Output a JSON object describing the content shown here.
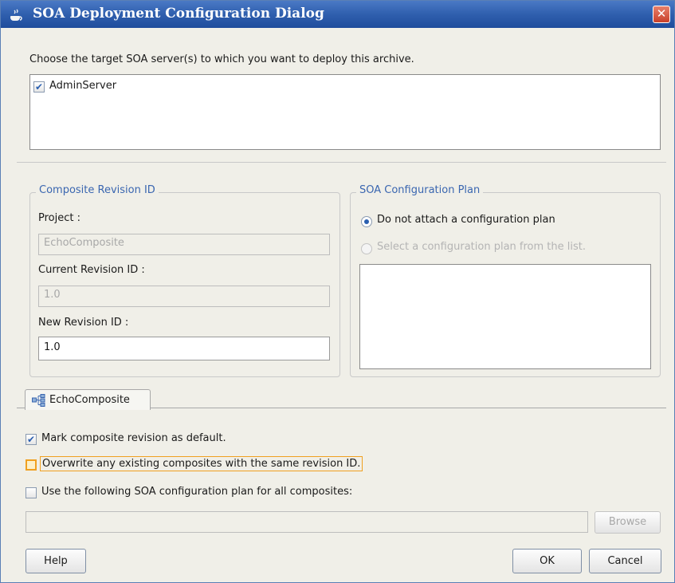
{
  "window": {
    "title": "SOA Deployment Configuration Dialog",
    "close_icon": "✕"
  },
  "target": {
    "prompt": "Choose the target SOA server(s) to which you want to deploy this archive.",
    "servers": [
      {
        "label": "AdminServer",
        "checked": true
      }
    ]
  },
  "revision": {
    "group_title": "Composite Revision ID",
    "project_label": "Project :",
    "project_value": "EchoComposite",
    "current_label": "Current Revision ID :",
    "current_value": "1.0",
    "new_label": "New Revision ID :",
    "new_value": "1.0"
  },
  "config_plan": {
    "group_title": "SOA Configuration Plan",
    "option_none": "Do not attach a configuration plan",
    "option_select": "Select a configuration plan from the list.",
    "selected": "option_none"
  },
  "tabs": [
    {
      "label": "EchoComposite",
      "icon": "composite-icon"
    }
  ],
  "options": {
    "mark_default": "Mark composite revision as default.",
    "mark_default_checked": true,
    "overwrite": "Overwrite any existing composites with the same revision ID.",
    "overwrite_checked": false,
    "use_plan": "Use the following SOA configuration plan for all composites:",
    "use_plan_checked": false,
    "plan_path": ""
  },
  "buttons": {
    "browse": "Browse",
    "help": "Help",
    "ok": "OK",
    "cancel": "Cancel"
  },
  "colors": {
    "title_bar": "#2f5fae",
    "accent": "#3a66b0",
    "highlight": "#f0a020"
  }
}
